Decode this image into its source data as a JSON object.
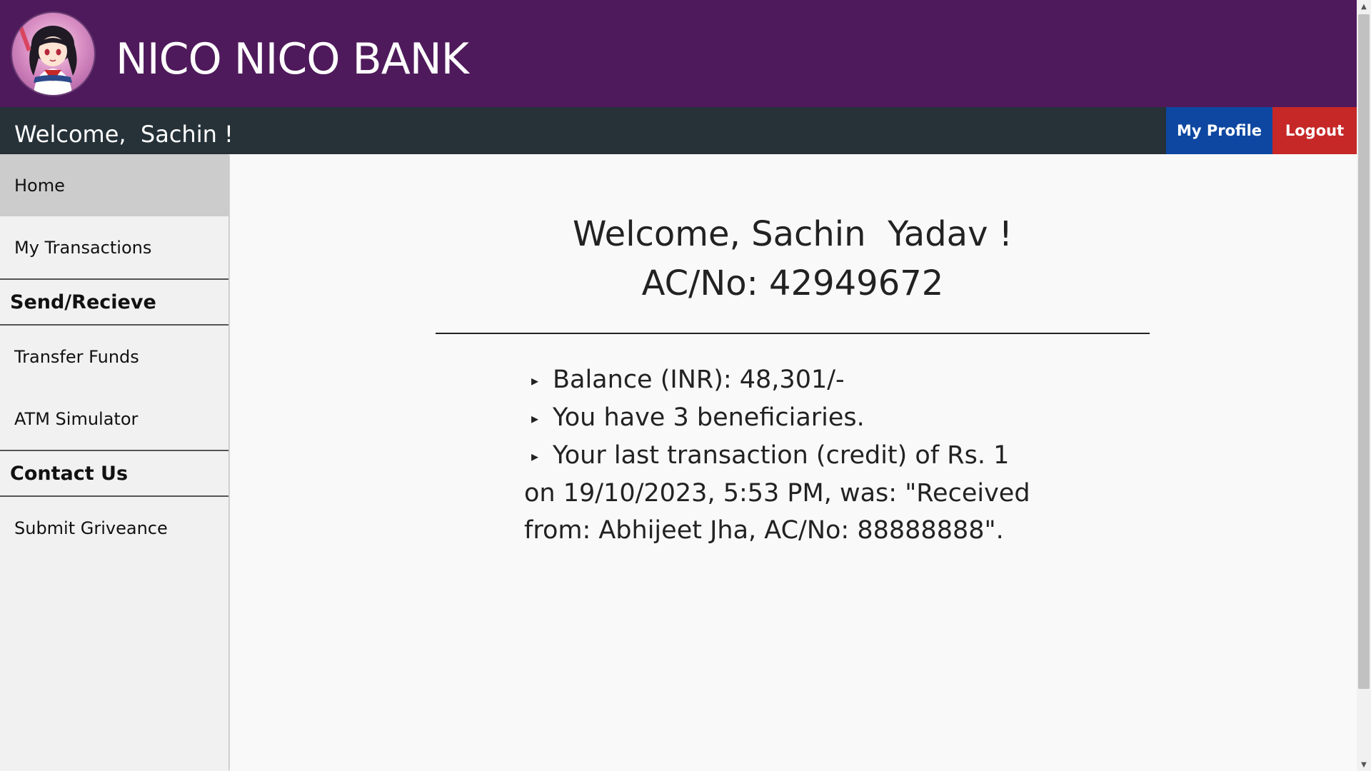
{
  "header": {
    "bank_name": "NICO NICO BANK",
    "logo_icon": "anime-mascot-logo"
  },
  "navbar": {
    "welcome_text": "Welcome,  Sachin !",
    "profile_label": "My Profile",
    "logout_label": "Logout"
  },
  "sidebar": {
    "items": [
      {
        "label": "Home",
        "active": true
      },
      {
        "label": "My Transactions"
      }
    ],
    "section_send": "Send/Recieve",
    "send_items": [
      {
        "label": "Transfer Funds"
      },
      {
        "label": "ATM Simulator"
      }
    ],
    "section_contact": "Contact Us",
    "contact_items": [
      {
        "label": "Submit Griveance"
      }
    ]
  },
  "main": {
    "greeting": "Welcome, Sachin  Yadav !",
    "account": "AC/No: 42949672",
    "bullet_glyph": "▸",
    "summary": [
      "Balance (INR): 48,301/-",
      "You have 3 beneficiaries.",
      "Your last transaction (credit) of Rs. 1 on 19/10/2023, 5:53 PM, was: \"Received from: Abhijeet Jha, AC/No: 88888888\"."
    ]
  },
  "colors": {
    "header_bg": "#4f1a5c",
    "navbar_bg": "#263238",
    "profile_btn": "#0d47a1",
    "logout_btn": "#c62828",
    "sidebar_bg": "#f1f1f1",
    "sidebar_active": "#cccccc"
  }
}
